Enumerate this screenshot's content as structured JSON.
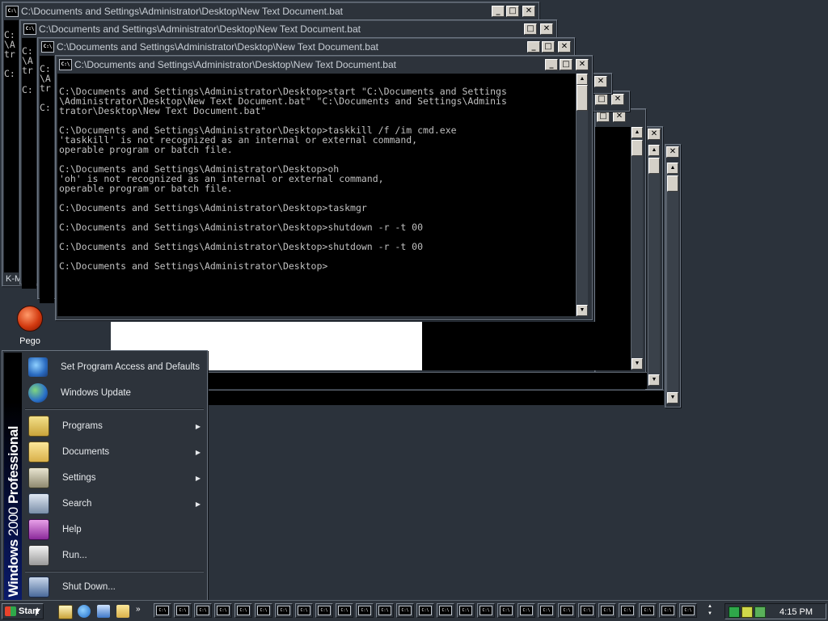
{
  "windows": {
    "title_1": "C:\\Documents and Settings\\Administrator\\Desktop\\New Text Document.bat",
    "title_2": "C:\\Documents and Settings\\Administrator\\Desktop\\New Text Document.bat",
    "title_3": "C:\\Documents and Settings\\Administrator\\Desktop\\New Text Document.bat",
    "title_4": "C:\\Documents and Settings\\Administrator\\Desktop\\New Text Document.bat",
    "icon_text": "C:\\",
    "minimize": "_",
    "maximize": "□",
    "close": "✕",
    "peek_1": "C:\n\\A\ntr\n\nC:",
    "peek_2": "C:\n\\A\ntr\n\nC:",
    "peek_3": "C:\n\\A\ntr\n\nC:",
    "peek_bottom": "K-M"
  },
  "console": {
    "text": "\nC:\\Documents and Settings\\Administrator\\Desktop>start \"C:\\Documents and Settings\n\\Administrator\\Desktop\\New Text Document.bat\" \"C:\\Documents and Settings\\Adminis\ntrator\\Desktop\\New Text Document.bat\"\n\nC:\\Documents and Settings\\Administrator\\Desktop>taskkill /f /im cmd.exe\n'taskkill' is not recognized as an internal or external command,\noperable program or batch file.\n\nC:\\Documents and Settings\\Administrator\\Desktop>oh\n'oh' is not recognized as an internal or external command,\noperable program or batch file.\n\nC:\\Documents and Settings\\Administrator\\Desktop>taskmgr\n\nC:\\Documents and Settings\\Administrator\\Desktop>shutdown -r -t 00\n\nC:\\Documents and Settings\\Administrator\\Desktop>shutdown -r -t 00\n\nC:\\Documents and Settings\\Administrator\\Desktop>"
  },
  "desktop": {
    "icon_label": "Pego"
  },
  "start_menu": {
    "banner_bold": "Windows",
    "banner_thin": "2000",
    "banner_tail": " Professional",
    "items": [
      {
        "label": "Set Program Access and Defaults",
        "icon": "program-access-icon"
      },
      {
        "label": "Windows Update",
        "icon": "windows-update-icon"
      },
      {
        "label": "Programs",
        "icon": "programs-icon"
      },
      {
        "label": "Documents",
        "icon": "documents-icon"
      },
      {
        "label": "Settings",
        "icon": "settings-icon"
      },
      {
        "label": "Search",
        "icon": "search-icon"
      },
      {
        "label": "Help",
        "icon": "help-icon"
      },
      {
        "label": "Run...",
        "icon": "run-icon"
      },
      {
        "label": "Shut Down...",
        "icon": "shutdown-icon"
      }
    ],
    "submenu_arrow": "▶"
  },
  "taskbar": {
    "start_label": "Start",
    "more": "»",
    "clock": "4:15 PM",
    "task_count_icon_text": "C:\\"
  },
  "colors": {
    "desktop": "#2b323b",
    "console_bg": "#000000",
    "console_fg": "#c0c0c0",
    "banner_blue": "#0a1a6a"
  }
}
